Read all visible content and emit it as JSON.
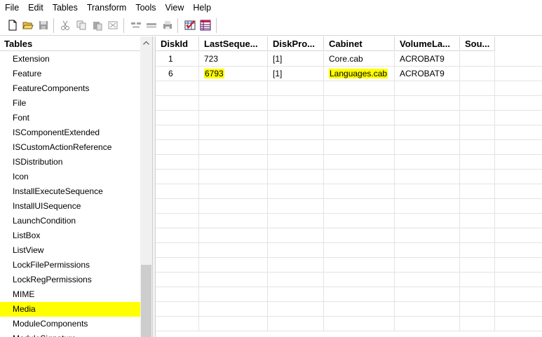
{
  "menu": [
    "File",
    "Edit",
    "Tables",
    "Transform",
    "Tools",
    "View",
    "Help"
  ],
  "toolbar": {
    "icons": [
      "new-icon",
      "open-icon",
      "save-icon",
      "cut-icon",
      "copy-icon",
      "paste-icon",
      "delete-icon",
      "find-icon",
      "replace-icon",
      "print-icon",
      "validate-icon",
      "table-icon"
    ]
  },
  "left": {
    "header": "Tables",
    "items": [
      "Extension",
      "Feature",
      "FeatureComponents",
      "File",
      "Font",
      "ISComponentExtended",
      "ISCustomActionReference",
      "ISDistribution",
      "Icon",
      "InstallExecuteSequence",
      "InstallUISequence",
      "LaunchCondition",
      "ListBox",
      "ListView",
      "LockFilePermissions",
      "LockRegPermissions",
      "MIME",
      "Media",
      "ModuleComponents",
      "ModuleSignature"
    ],
    "selected": "Media"
  },
  "grid": {
    "columns": [
      "DiskId",
      "LastSeque...",
      "DiskPro...",
      "Cabinet",
      "VolumeLa...",
      "Sou..."
    ],
    "rows": [
      [
        "1",
        "723",
        "[1]",
        "Core.cab",
        "ACROBAT9",
        ""
      ],
      [
        "6",
        "6793",
        "[1]",
        "Languages.cab",
        "ACROBAT9",
        ""
      ]
    ]
  },
  "colors": {
    "selection": "#ffff00",
    "highlight": "#ffff00"
  }
}
